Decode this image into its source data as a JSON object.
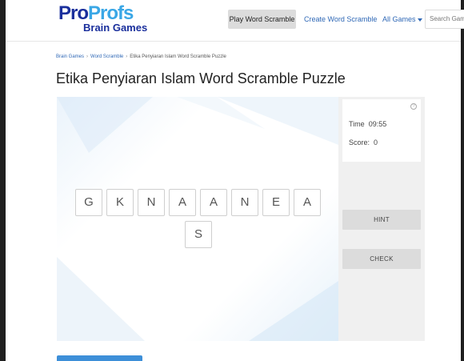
{
  "logo": {
    "pro": "Pro",
    "profs": "Profs",
    "sub": "Brain Games"
  },
  "nav": {
    "play": "Play Word Scramble",
    "create": "Create Word Scramble",
    "all": "All Games",
    "search_placeholder": "Search Games"
  },
  "breadcrumb": [
    "Brain Games",
    "Word Scramble",
    "Etika Penyiaran Islam Word Scramble Puzzle"
  ],
  "page_title": "Etika Penyiaran Islam Word Scramble Puzzle",
  "tiles": [
    "G",
    "K",
    "N",
    "A",
    "A",
    "N",
    "E",
    "A",
    "S"
  ],
  "stats": {
    "time_label": "Time",
    "time_value": "09:55",
    "score_label": "Score:",
    "score_value": "0"
  },
  "buttons": {
    "hint": "HINT",
    "check": "CHECK"
  },
  "colors": {
    "brand_dark": "#1a2f9c",
    "brand_light": "#3aa7e6",
    "link": "#2f68b6",
    "primary_button": "#3d8fd8"
  },
  "icons": {
    "info": "info-icon",
    "dropdown": "caret-down-icon"
  }
}
